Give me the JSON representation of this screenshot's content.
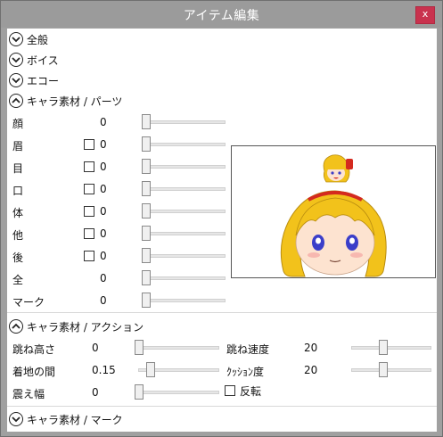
{
  "window": {
    "title": "アイテム編集",
    "close_label": "x"
  },
  "sections": {
    "general": "全般",
    "voice": "ボイス",
    "echo": "エコー",
    "parts": "キャラ素材 / パーツ",
    "action": "キャラ素材 / アクション",
    "mark": "キャラ素材 / マーク"
  },
  "parts": [
    {
      "label": "顔",
      "value": "0",
      "has_checkbox": false,
      "checked": false
    },
    {
      "label": "眉",
      "value": "0",
      "has_checkbox": true,
      "checked": false
    },
    {
      "label": "目",
      "value": "0",
      "has_checkbox": true,
      "checked": false
    },
    {
      "label": "口",
      "value": "0",
      "has_checkbox": true,
      "checked": false
    },
    {
      "label": "体",
      "value": "0",
      "has_checkbox": true,
      "checked": false
    },
    {
      "label": "他",
      "value": "0",
      "has_checkbox": true,
      "checked": false
    },
    {
      "label": "後",
      "value": "0",
      "has_checkbox": true,
      "checked": false
    },
    {
      "label": "全",
      "value": "0",
      "has_checkbox": false,
      "checked": false
    },
    {
      "label": "マーク",
      "value": "0",
      "has_checkbox": false,
      "checked": false
    }
  ],
  "action": {
    "jump_height": {
      "label": "跳ね高さ",
      "value": "0"
    },
    "landing": {
      "label": "着地の間",
      "value": "0.15"
    },
    "shake": {
      "label": "震え幅",
      "value": "0"
    },
    "jump_speed": {
      "label": "跳ね速度",
      "value": "20"
    },
    "cushion": {
      "label": "ｸｯｼｮﾝ度",
      "value": "20"
    },
    "invert": {
      "label": "反転",
      "checked": false
    }
  },
  "colors": {
    "titlebar": "#9b9b9b",
    "close": "#c9324e",
    "hair": "#f2c21b",
    "ribbon": "#d42a1f",
    "eye": "#3b3ec9"
  }
}
